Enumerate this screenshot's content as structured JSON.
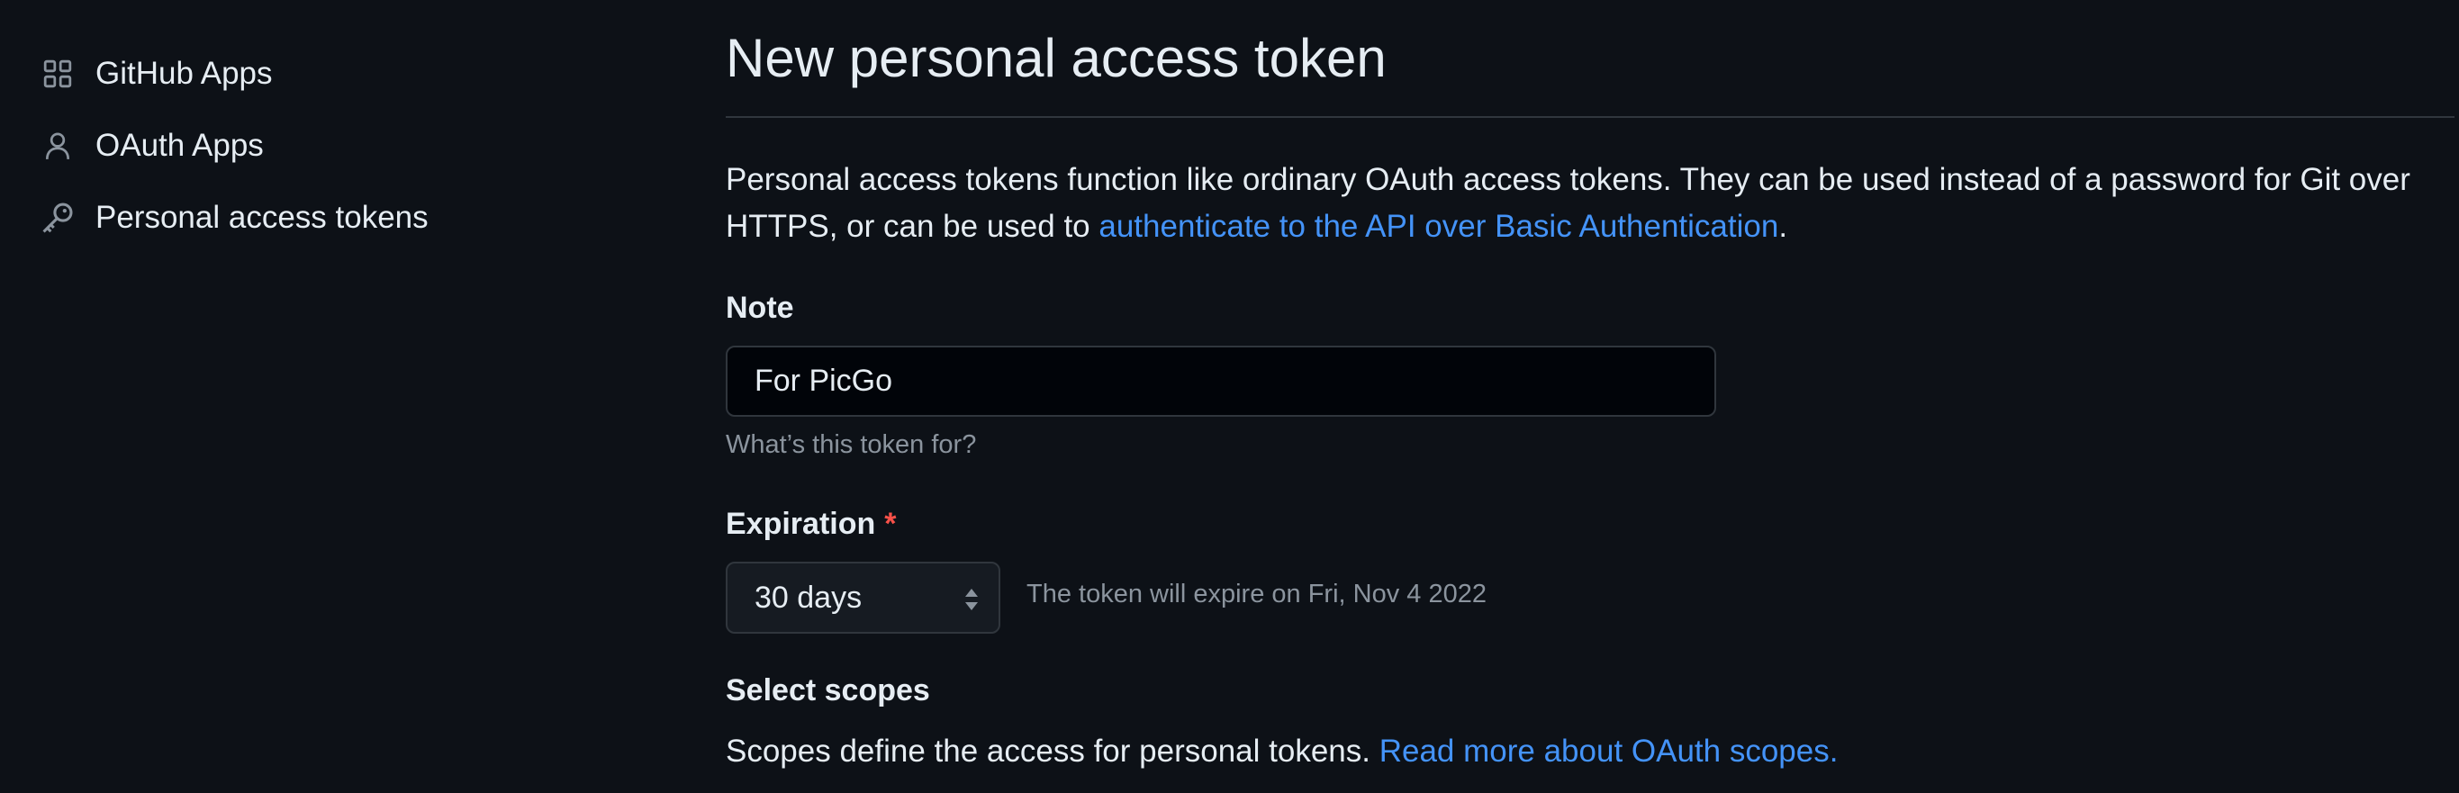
{
  "sidebar": {
    "items": [
      {
        "label": "GitHub Apps",
        "icon": "apps-grid-icon"
      },
      {
        "label": "OAuth Apps",
        "icon": "person-icon"
      },
      {
        "label": "Personal access tokens",
        "icon": "key-icon"
      }
    ]
  },
  "main": {
    "title": "New personal access token",
    "intro": {
      "text_before": "Personal access tokens function like ordinary OAuth access tokens. They can be used instead of a password for Git over HTTPS, or can be used to ",
      "link": "authenticate to the API over Basic Authentication",
      "text_after": "."
    },
    "note": {
      "label": "Note",
      "value": "For PicGo",
      "hint": "What’s this token for?"
    },
    "expiration": {
      "label": "Expiration",
      "required_mark": "*",
      "selected": "30 days",
      "expire_note": "The token will expire on Fri, Nov 4 2022"
    },
    "scopes": {
      "heading": "Select scopes",
      "text": "Scopes define the access for personal tokens.",
      "link": "Read more about OAuth scopes."
    }
  },
  "colors": {
    "background": "#0d1117",
    "text": "#e6edf3",
    "muted": "#8b949e",
    "link": "#4493f8",
    "required": "#f85149",
    "border": "#30363d"
  }
}
